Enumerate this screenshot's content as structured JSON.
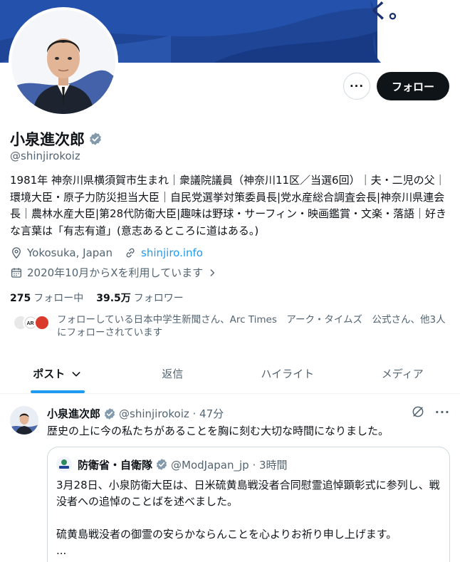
{
  "banner": {
    "text": "く。"
  },
  "profile": {
    "display_name": "小泉進次郎",
    "handle": "@shinjirokoiz",
    "more_label": "···",
    "follow_label": "フォロー",
    "bio": "1981年 神奈川県横須賀市生まれ｜衆議院議員（神奈川11区／当選6回）｜夫・二児の父｜環境大臣・原子力防災担当大臣｜自民党選挙対策委員長|党水産総合調査会長|神奈川県連会長｜農林水産大臣|第28代防衛大臣|趣味は野球・サーフィン・映画鑑賞・文楽・落語｜好きな言葉は「有志有道」(意志あるところに道はある。)",
    "location": "Yokosuka, Japan",
    "website": "shinjiro.info",
    "joined": "2020年10月からXを利用しています",
    "following_count": "275",
    "following_label": "フォロー中",
    "followers_count": "39.5万",
    "followers_label": "フォロワー",
    "followed_by": "フォローしている日本中学生新聞さん、Arc Times　アーク・タイムズ　公式さん、他3人にフォローされています"
  },
  "tabs": [
    {
      "label": "ポスト"
    },
    {
      "label": "返信"
    },
    {
      "label": "ハイライト"
    },
    {
      "label": "メディア"
    }
  ],
  "post": {
    "name": "小泉進次郎",
    "handle_time": "@shinjirokoiz · 47分",
    "text": "歴史の上に今の私たちがあることを胸に刻む大切な時間になりました。",
    "more_label": "···",
    "quote": {
      "name": "防衛省・自衛隊",
      "handle_time": "@ModJapan_jp · 3時間",
      "line1": "3月28日、小泉防衛大臣は、日米硫黄島戦没者合同慰霊追悼顕彰式に参列し、戦没者への追悼のことばを述べました。",
      "line2": "硫黄島戦没者の御霊の安らかならんことを心よりお祈り申し上げます。",
      "line3": "..."
    }
  },
  "colors": {
    "accent": "#1d9bf0",
    "banner": "#1e4596",
    "follow_button": "#0f1419",
    "secondary_text": "#536471"
  }
}
